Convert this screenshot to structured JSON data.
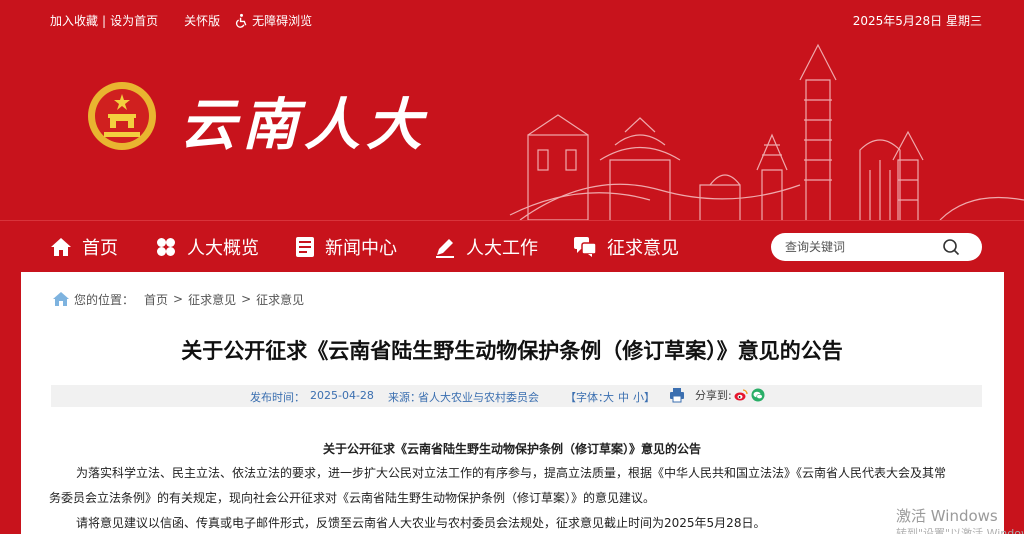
{
  "topbar": {
    "favorite": "加入收藏",
    "separator": "|",
    "homepage": "设为首页",
    "care_mode": "关怀版",
    "accessible": "无障碍浏览",
    "date": "2025年5月28日 星期三"
  },
  "logo": {
    "text": "云南人大"
  },
  "nav": {
    "items": [
      {
        "label": "首页",
        "icon": "home-icon"
      },
      {
        "label": "人大概览",
        "icon": "clover-icon"
      },
      {
        "label": "新闻中心",
        "icon": "document-icon"
      },
      {
        "label": "人大工作",
        "icon": "pen-icon"
      },
      {
        "label": "征求意见",
        "icon": "chat-icon"
      }
    ],
    "search_placeholder": "查询关键词"
  },
  "breadcrumb": {
    "label": "您的位置：",
    "items": [
      "首页",
      "征求意见",
      "征求意见"
    ],
    "sep": ">"
  },
  "article": {
    "title": "关于公开征求《云南省陆生野生动物保护条例（修订草案）》意见的公告",
    "meta": {
      "publish_label": "发布时间：",
      "publish_date": "2025-04-28",
      "source_label": "来源：",
      "source": "省人大农业与农村委员会",
      "font_label": "【字体：",
      "font_large": "大",
      "font_medium": "中",
      "font_small": "小】",
      "share_label": "分享到:"
    },
    "subtitle": "关于公开征求《云南省陆生野生动物保护条例（修订草案）》意见的公告",
    "para1_line1": "为落实科学立法、民主立法、依法立法的要求，进一步扩大公民对立法工作的有序参与，提高立法质量，根据《中华人民共和国立法法》《云南省人民代表大会及其常",
    "para1_line2": "务委员会立法条例》的有关规定，现向社会公开征求对《云南省陆生野生动物保护条例（修订草案）》的意见建议。",
    "para2": "请将意见建议以信函、传真或电子邮件形式，反馈至云南省人大农业与农村委员会法规处，征求意见截止时间为2025年5月28日。"
  },
  "watermark": {
    "line1": "激活 Windows",
    "line2": "转到\"设置\"以激活 Windows。"
  },
  "colors": {
    "brand_red": "#c8131c",
    "link_blue": "#3b6fb0"
  }
}
